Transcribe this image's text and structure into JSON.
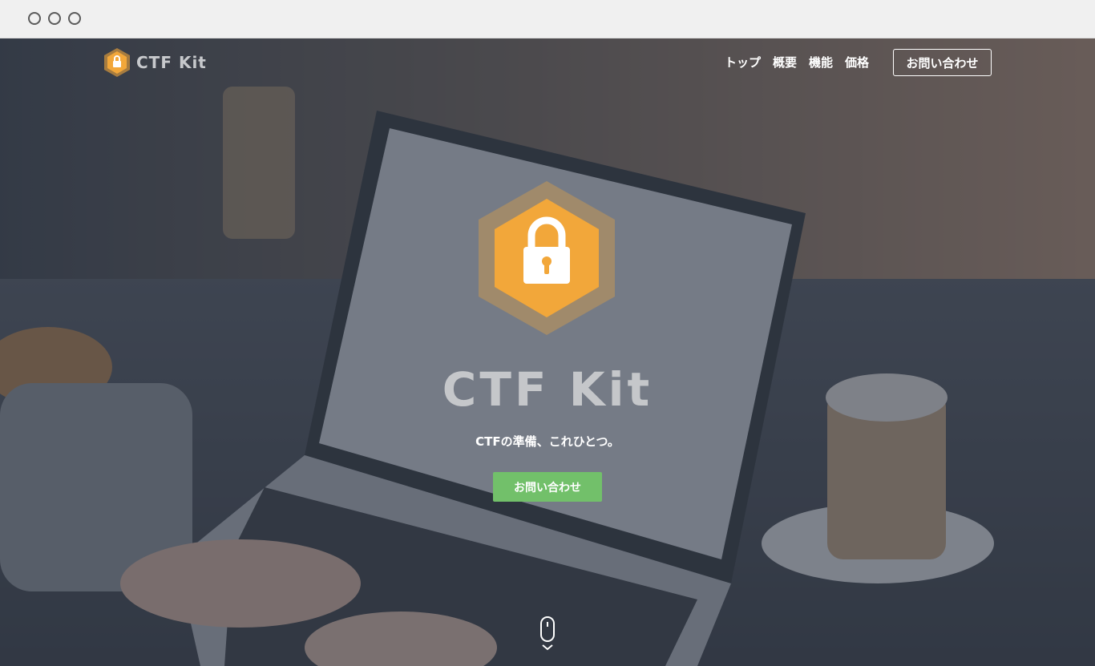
{
  "browser": {
    "controls": [
      "close",
      "minimize",
      "maximize"
    ]
  },
  "brand": {
    "name": "CTF Kit",
    "logo_icon": "lock-hexagon-icon",
    "accent_color": "#f2a73a"
  },
  "nav": {
    "links": [
      {
        "label": "トップ"
      },
      {
        "label": "概要"
      },
      {
        "label": "機能"
      },
      {
        "label": "価格"
      }
    ],
    "contact_label": "お問い合わせ"
  },
  "hero": {
    "title": "CTF Kit",
    "tagline": "CTFの準備、これひとつ。",
    "cta_label": "お問い合わせ",
    "cta_color": "#72c06a",
    "scroll_icon": "mouse-scroll-icon"
  }
}
